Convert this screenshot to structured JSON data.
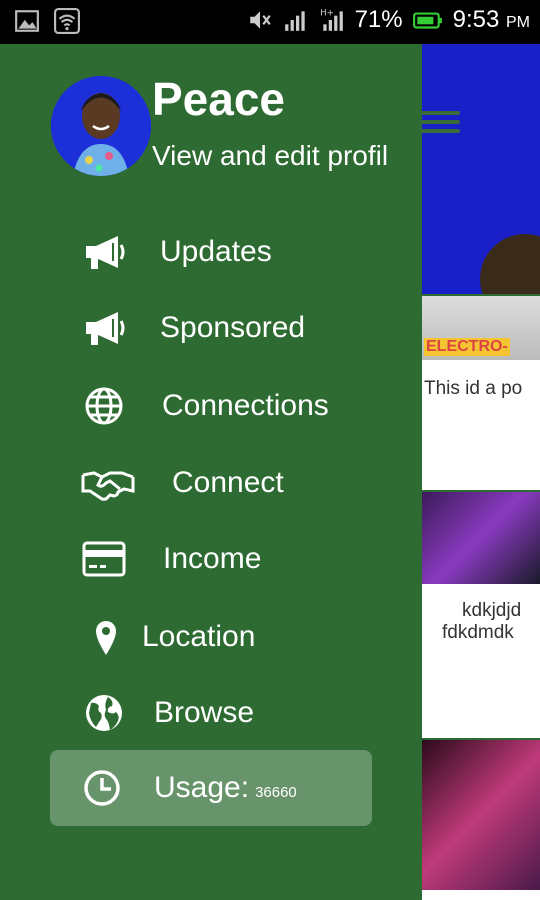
{
  "status_bar": {
    "battery_percent": "71%",
    "time": "9:53",
    "ampm": "PM",
    "icons": [
      "image-icon",
      "wifi-icon",
      "mute-icon",
      "signal-icon",
      "signal-h-icon",
      "battery-icon"
    ]
  },
  "drawer": {
    "profile": {
      "name": "Peace",
      "subtitle": "View and edit profil"
    },
    "menu": [
      {
        "label": "Updates",
        "icon": "megaphone-icon"
      },
      {
        "label": "Sponsored",
        "icon": "megaphone-icon"
      },
      {
        "label": "Connections",
        "icon": "globe-icon"
      },
      {
        "label": "Connect",
        "icon": "handshake-icon"
      },
      {
        "label": "Income",
        "icon": "credit-card-icon"
      },
      {
        "label": "Location",
        "icon": "location-pin-icon"
      },
      {
        "label": "Browse",
        "icon": "earth-icon"
      },
      {
        "label": "Usage:",
        "icon": "clock-icon",
        "value": "36660",
        "active": true
      }
    ],
    "colors": {
      "drawer_bg": "#2e6b33",
      "active_item": "rgba(255,255,255,0.28)"
    }
  },
  "background": {
    "header_color": "#1a20c8",
    "cards": [
      {
        "banner": "ELECTRO-",
        "text": "This id a po"
      },
      {
        "text_line1": "kdkjdjd",
        "text_line2": "fdkdmdk"
      },
      {
        "text": ""
      }
    ]
  }
}
